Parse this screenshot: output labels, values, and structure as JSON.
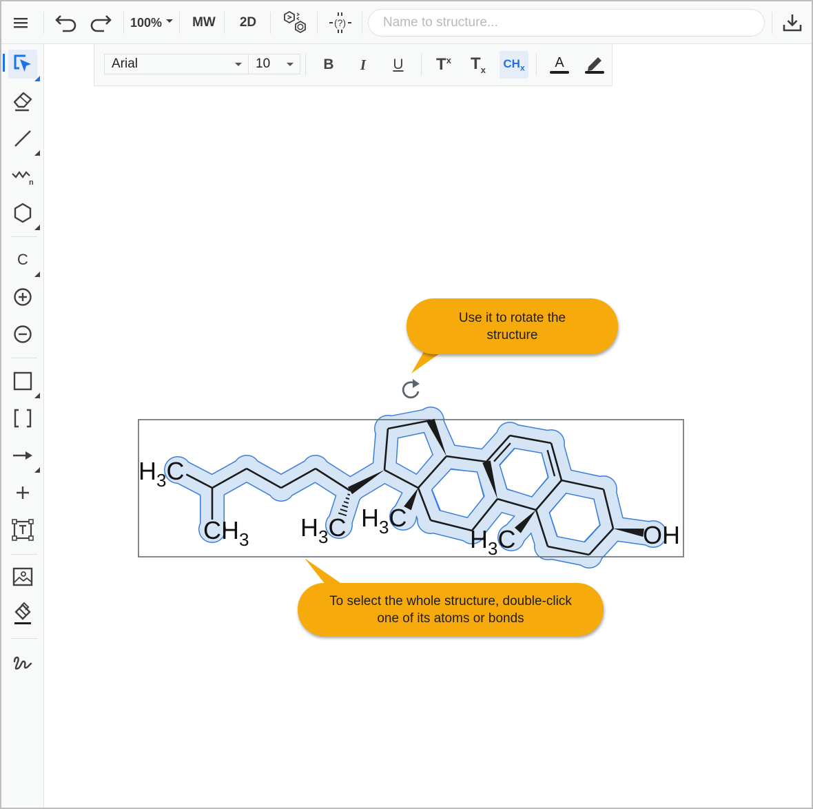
{
  "topbar": {
    "menu_icon": "hamburger-menu-icon",
    "undo_icon": "undo-icon",
    "redo_icon": "redo-icon",
    "zoom_level": "100%",
    "mw_label": "MW",
    "clean_label": "2D",
    "structure_swap_icon": "ring-swap-icon",
    "query_atom_icon": "query-atom-icon",
    "name_to_structure_placeholder": "Name to structure...",
    "name_to_structure_value": "",
    "export_icon": "download-icon"
  },
  "sidebar": {
    "items": [
      {
        "id": "select",
        "icon": "select-arrow-icon",
        "active": true,
        "has_submenu": true
      },
      {
        "id": "eraser",
        "icon": "eraser-icon",
        "active": false,
        "has_submenu": false
      },
      {
        "id": "bond",
        "icon": "single-bond-icon",
        "active": false,
        "has_submenu": true
      },
      {
        "id": "chain",
        "icon": "chain-n-icon",
        "active": false,
        "has_submenu": false
      },
      {
        "id": "ring",
        "icon": "hexagon-ring-icon",
        "active": false,
        "has_submenu": true
      },
      {
        "id": "atom",
        "icon": "carbon-atom-icon",
        "label": "C",
        "active": false,
        "has_submenu": true
      },
      {
        "id": "charge-plus",
        "icon": "charge-plus-icon",
        "active": false,
        "has_submenu": false
      },
      {
        "id": "charge-minus",
        "icon": "charge-minus-icon",
        "active": false,
        "has_submenu": false
      },
      {
        "id": "shape",
        "icon": "rectangle-shape-icon",
        "active": false,
        "has_submenu": true
      },
      {
        "id": "bracket",
        "icon": "brackets-icon",
        "label": "[ ]",
        "active": false,
        "has_submenu": false
      },
      {
        "id": "arrow",
        "icon": "reaction-arrow-icon",
        "active": false,
        "has_submenu": true
      },
      {
        "id": "plus",
        "icon": "reaction-plus-icon",
        "active": false,
        "has_submenu": false
      },
      {
        "id": "text",
        "icon": "text-box-icon",
        "active": false,
        "has_submenu": false
      },
      {
        "id": "image",
        "icon": "image-icon",
        "active": false,
        "has_submenu": false
      },
      {
        "id": "fill",
        "icon": "paint-fill-icon",
        "active": false,
        "has_submenu": false
      },
      {
        "id": "freehand",
        "icon": "freehand-draw-icon",
        "active": false,
        "has_submenu": false
      }
    ]
  },
  "format_toolbar": {
    "font_family": "Arial",
    "font_size": "10",
    "bold_label": "B",
    "italic_label": "I",
    "underline_label": "U",
    "superscript_label": "T",
    "superscript_mark": "x",
    "subscript_label": "T",
    "subscript_mark": "x",
    "chem_subscript_label": "CH",
    "chem_subscript_mark": "x",
    "chem_subscript_active": true,
    "text_color_label": "A",
    "text_color": "#1e1e1e",
    "highlight_color": "#1e1e1e"
  },
  "canvas": {
    "rotate_icon": "rotate-icon",
    "selection_color": "#3b7ddd",
    "selection_fill": "#d6e5f6",
    "callouts": [
      {
        "text": "Use it to rotate the structure",
        "color": "#f6aa0c"
      },
      {
        "text": "To select the whole structure, double-click one of its atoms or bonds",
        "color": "#f6aa0c"
      }
    ],
    "atom_labels": {
      "methyl_left_H": "H",
      "methyl_left_sub": "3",
      "methyl_left_C": "C",
      "methyl_branch_C": "CH",
      "methyl_branch_sub": "3",
      "methyl_c20_H": "H",
      "methyl_c20_sub": "3",
      "methyl_c20_C": "C",
      "methyl_c18_H": "H",
      "methyl_c18_sub": "3",
      "methyl_c18_C": "C",
      "methyl_c19_H": "H",
      "methyl_c19_sub": "3",
      "methyl_c19_C": "C",
      "hydroxyl": "OH"
    }
  }
}
